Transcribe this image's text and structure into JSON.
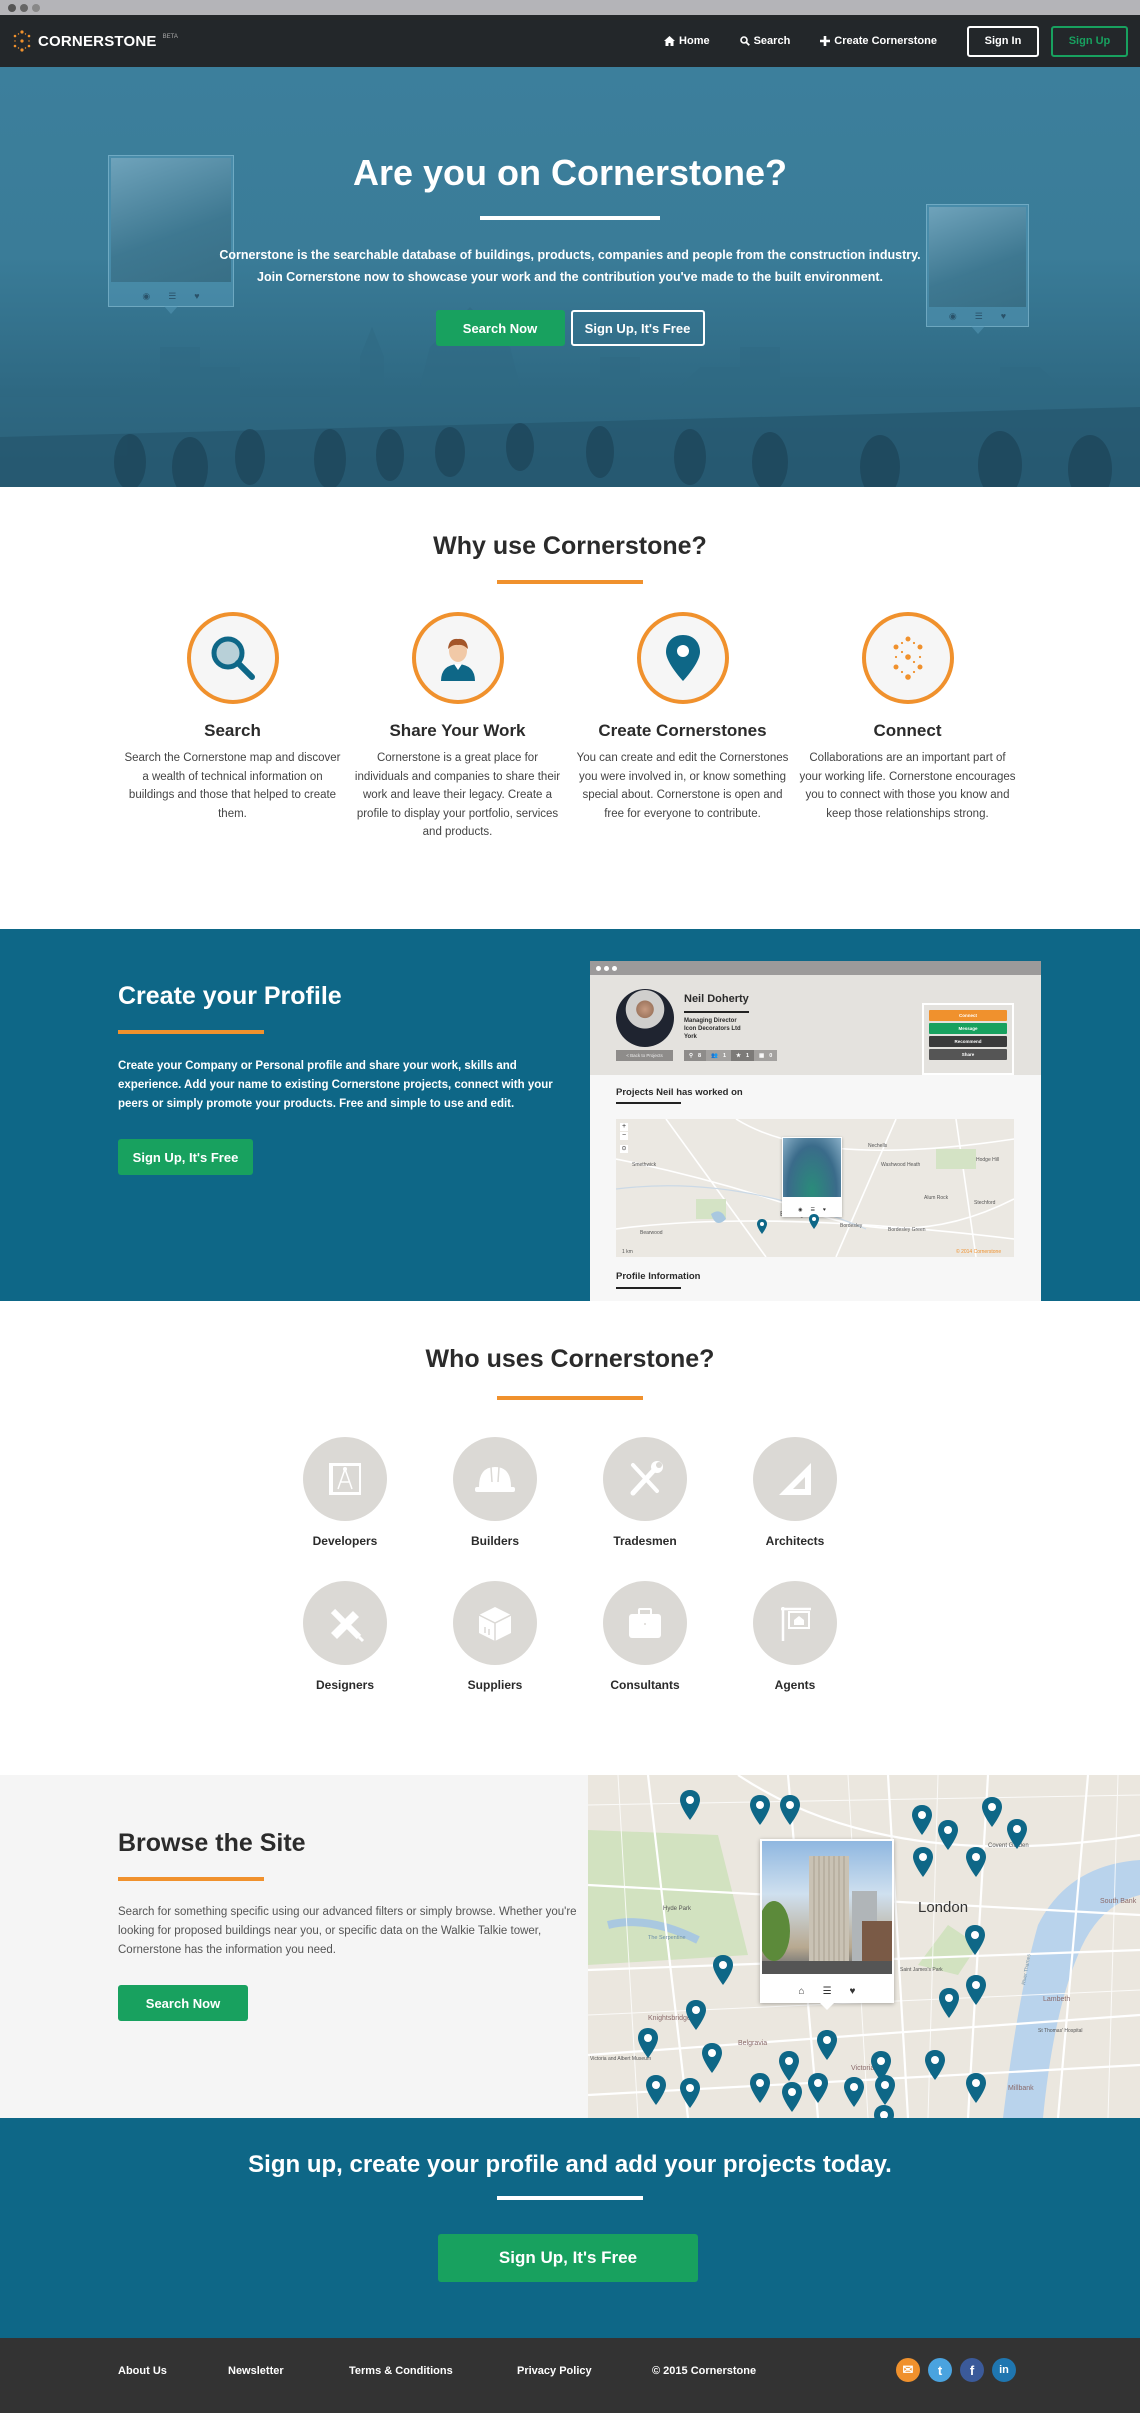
{
  "browser": {
    "dots": [
      "close",
      "minimize",
      "maximize"
    ]
  },
  "nav": {
    "logo_name": "CORNERSTONE",
    "logo_badge": "BETA",
    "links": [
      {
        "icon": "home-icon",
        "label": "Home"
      },
      {
        "icon": "search-icon",
        "label": "Search"
      },
      {
        "icon": "plus-icon",
        "label": "Create Cornerstone"
      }
    ],
    "sign_in": "Sign In",
    "sign_up": "Sign Up"
  },
  "hero": {
    "title": "Are you on Cornerstone?",
    "desc_line1": "Cornerstone is the searchable database of buildings, products, companies and people from the construction industry.",
    "desc_line2": "Join Cornerstone now to showcase your work and the contribution you've made to the built environment.",
    "search_btn": "Search Now",
    "signup_btn": "Sign Up, It's Free",
    "card_icons": [
      "eye-icon",
      "list-icon",
      "heart-icon"
    ]
  },
  "why": {
    "title": "Why use Cornerstone?",
    "features": [
      {
        "title": "Search",
        "desc": "Search the Cornerstone map and discover a wealth of technical information on buildings and those that helped to create them."
      },
      {
        "title": "Share Your Work",
        "desc": "Cornerstone is a great place for individuals and companies to share their work and leave their legacy. Create a profile to display your portfolio, services and products."
      },
      {
        "title": "Create Cornerstones",
        "desc": "You can create and edit the Cornerstones you were involved in, or know something special about. Cornerstone is open and free for everyone to contribute."
      },
      {
        "title": "Connect",
        "desc": "Collaborations are an important part of your working life. Cornerstone encourages you to connect with those you know and keep those relationships strong."
      }
    ]
  },
  "profile_section": {
    "title": "Create your Profile",
    "desc": "Create your Company or Personal profile and share your work, skills and experience. Add your name to existing Cornerstone projects, connect with your peers or simply promote your products. Free and simple to use and edit.",
    "button": "Sign Up, It's Free",
    "mock": {
      "name": "Neil Doherty",
      "role": "Managing Director",
      "company": "Icon Decorators Ltd",
      "location": "York",
      "back_btn": "< Back to Projects",
      "stats": [
        {
          "icon": "pin-icon",
          "value": "8"
        },
        {
          "icon": "people-icon",
          "value": "1"
        },
        {
          "icon": "star-icon",
          "value": "1"
        },
        {
          "icon": "shirt-icon",
          "value": "0"
        }
      ],
      "actions": [
        {
          "label": "Connect",
          "color": "#f0912d"
        },
        {
          "label": "Message",
          "color": "#18a15f"
        },
        {
          "label": "Recommend",
          "color": "#3a3a3a"
        },
        {
          "label": "Share",
          "color": "#555555"
        }
      ],
      "projects_heading": "Projects Neil has worked on",
      "profile_heading": "Profile Information",
      "map_labels": [
        "Smethwick",
        "Birmingham",
        "Bearwood",
        "Nechells",
        "Washwood Heath",
        "Bordesley",
        "Alum Rock",
        "Stechford",
        "Hodge Hill",
        "Bordesley Green"
      ],
      "map_attribution": "© 2014 Cornerstone",
      "map_scale": "1 km"
    }
  },
  "who": {
    "title": "Who uses Cornerstone?",
    "roles": [
      {
        "label": "Developers",
        "icon": "blueprint-icon"
      },
      {
        "label": "Builders",
        "icon": "hard-hat-icon"
      },
      {
        "label": "Tradesmen",
        "icon": "tools-icon"
      },
      {
        "label": "Architects",
        "icon": "set-square-icon"
      },
      {
        "label": "Designers",
        "icon": "pencil-ruler-icon"
      },
      {
        "label": "Suppliers",
        "icon": "box-icon"
      },
      {
        "label": "Consultants",
        "icon": "briefcase-icon"
      },
      {
        "label": "Agents",
        "icon": "sale-sign-icon"
      }
    ]
  },
  "browse": {
    "title": "Browse the Site",
    "desc": "Search for something specific using our advanced filters or simply browse. Whether you're looking for proposed buildings near you, or specific data on the Walkie Talkie tower, Cornerstone has the information you need.",
    "button": "Search Now",
    "map_labels": [
      "London",
      "Hyde Park",
      "The Serpentine",
      "Covent Garden",
      "South Bank",
      "Knightsbridge",
      "Belgravia",
      "Victoria",
      "Lambeth",
      "St Thomas' Hospital",
      "Millbank",
      "Saint James's Park",
      "Victoria and Albert Museum",
      "River Thames"
    ],
    "popup_icons": [
      "home-icon",
      "list-icon",
      "heart-icon"
    ]
  },
  "cta": {
    "title": "Sign up, create your profile and add your projects today.",
    "button": "Sign Up, It's Free"
  },
  "footer": {
    "links": [
      "About Us",
      "Newsletter",
      "Terms & Conditions",
      "Privacy Policy"
    ],
    "copyright": "© 2015 Cornerstone",
    "social": [
      {
        "name": "email",
        "color": "#f0912d",
        "glyph": "✉"
      },
      {
        "name": "twitter",
        "color": "#4aa3df",
        "glyph": "t"
      },
      {
        "name": "facebook",
        "color": "#3b5a9a",
        "glyph": "f"
      },
      {
        "name": "linkedin",
        "color": "#1f76b0",
        "glyph": "in"
      }
    ]
  },
  "colors": {
    "brand_blue": "#0e6787",
    "accent_orange": "#f0912d",
    "action_green": "#18a15f",
    "nav_dark": "#23272a",
    "pin_blue": "#0e6787"
  }
}
